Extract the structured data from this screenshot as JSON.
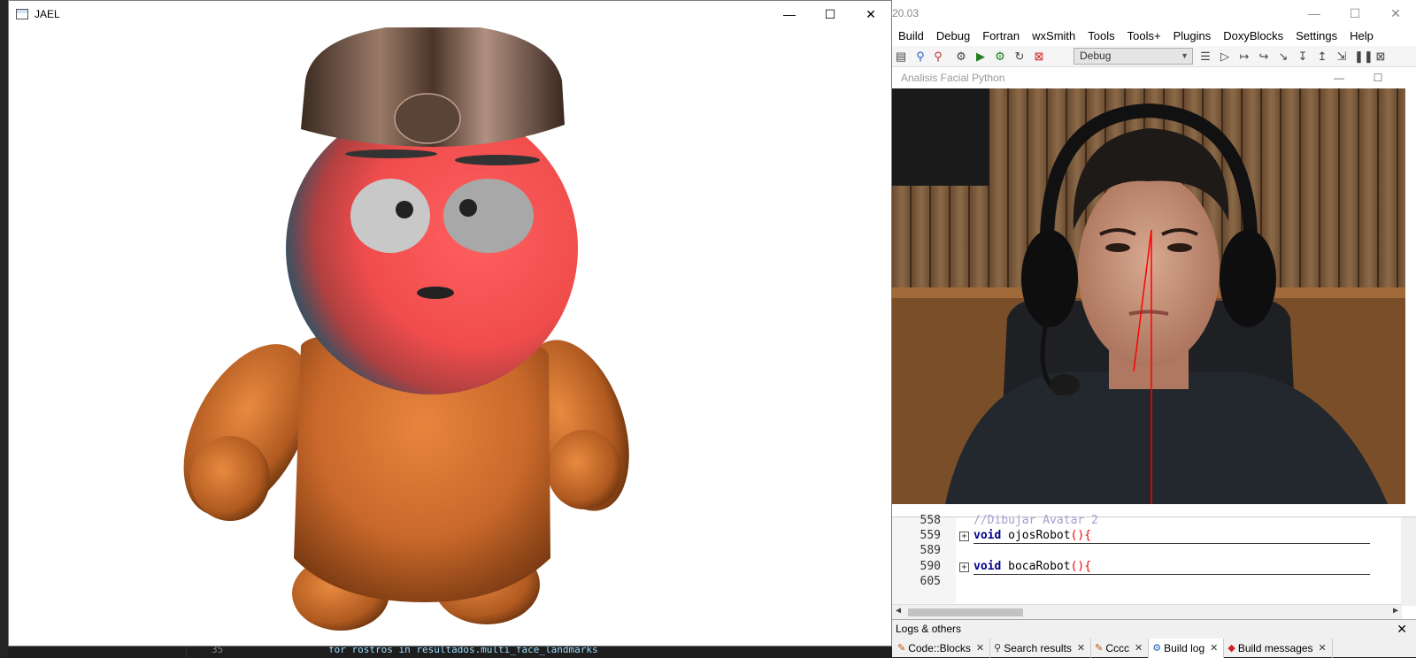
{
  "background_editor": {
    "line_number": "35",
    "code_text": "for rostros in resultados.multi_face_landmarks"
  },
  "jael_window": {
    "title": "JAEL",
    "controls": {
      "minimize": "—",
      "maximize": "☐",
      "close": "✕"
    }
  },
  "ide": {
    "title_fragment": "20.03",
    "menu": [
      "Build",
      "Debug",
      "Fortran",
      "wxSmith",
      "Tools",
      "Tools+",
      "Plugins",
      "DoxyBlocks",
      "Settings",
      "Help"
    ],
    "build_target": "Debug",
    "face_window": {
      "title": "Analisis Facial Python"
    },
    "code_lines": [
      {
        "num": "558",
        "text": "//Dibujar Avatar 2",
        "kind": "comment"
      },
      {
        "num": "559",
        "keyword": "void",
        "name": "ojosRobot",
        "kind": "func"
      },
      {
        "num": "589",
        "text": "",
        "kind": "blank"
      },
      {
        "num": "590",
        "keyword": "void",
        "name": "bocaRobot",
        "kind": "func"
      },
      {
        "num": "605",
        "text": "",
        "kind": "blank"
      }
    ],
    "logs": {
      "header": "Logs & others",
      "tabs": [
        "Code::Blocks",
        "Search results",
        "Cccc",
        "Build log",
        "Build messages"
      ],
      "active_tab": "Build log"
    }
  },
  "colors": {
    "avatar_head": "#f05050",
    "avatar_body": "#c8682a",
    "line_overlay": "#ff0000"
  }
}
